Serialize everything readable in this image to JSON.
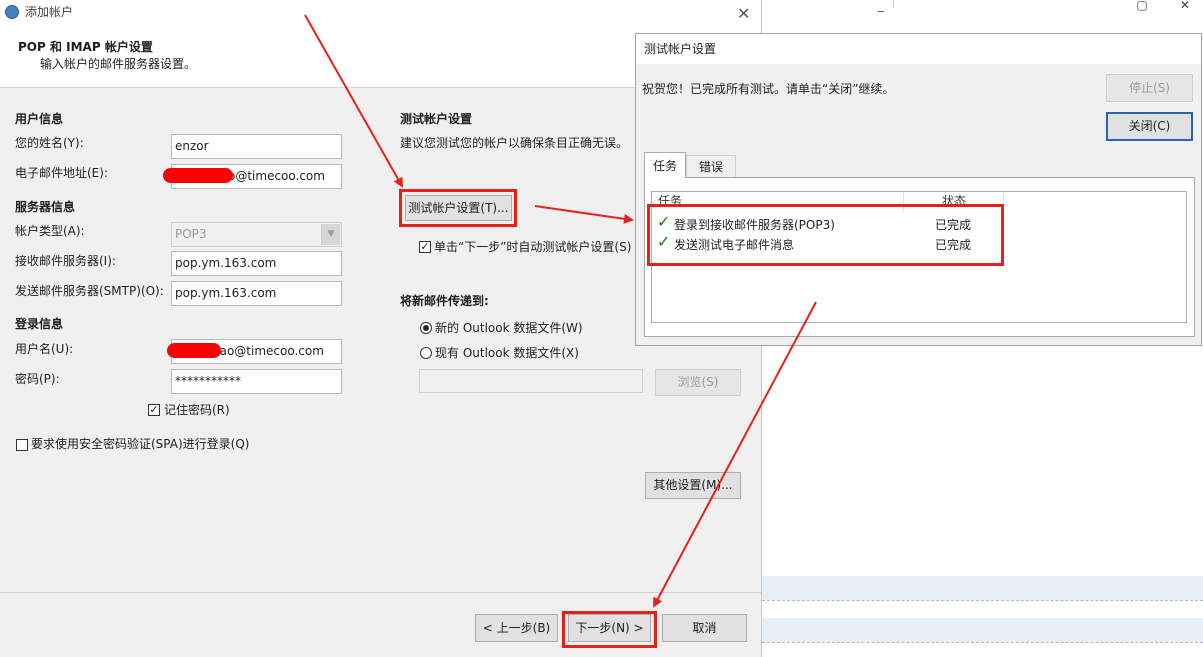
{
  "background_app": {
    "close_glyph": "✕"
  },
  "main_dialog": {
    "window_title": "添加帐户",
    "close_glyph": "✕",
    "header": {
      "title": "POP 和 IMAP 帐户设置",
      "subtitle": "输入帐户的邮件服务器设置。"
    },
    "user_info": {
      "section_label": "用户信息",
      "name_label": "您的姓名(Y):",
      "name_value": "enzor",
      "email_label": "电子邮件地址(E):",
      "email_value": "o@timecoo.com"
    },
    "server_info": {
      "section_label": "服务器信息",
      "account_type_label": "帐户类型(A):",
      "account_type_value": "POP3",
      "incoming_label": "接收邮件服务器(I):",
      "incoming_value": "pop.ym.163.com",
      "outgoing_label": "发送邮件服务器(SMTP)(O):",
      "outgoing_value": "pop.ym.163.com"
    },
    "login_info": {
      "section_label": "登录信息",
      "username_label": "用户名(U):",
      "username_value": "hao@timecoo.com",
      "password_label": "密码(P):",
      "password_value": "***********",
      "remember_label": "记住密码(R)",
      "remember_checked": true,
      "spa_label": "要求使用安全密码验证(SPA)进行登录(Q)",
      "spa_checked": false
    },
    "test_settings": {
      "section_label": "测试帐户设置",
      "description": "建议您测试您的帐户以确保条目正确无误。",
      "test_button": "测试帐户设置(T)...",
      "auto_test_label": "单击“下一步”时自动测试帐户设置(S)",
      "auto_test_checked": true
    },
    "deliver_to": {
      "section_label": "将新邮件传递到:",
      "option_new": "新的 Outlook 数据文件(W)",
      "option_existing": "现有 Outlook 数据文件(X)",
      "selected": "new",
      "existing_path": "",
      "browse_button": "浏览(S)"
    },
    "more_settings_button": "其他设置(M)...",
    "footer": {
      "back_button": "< 上一步(B)",
      "next_button": "下一步(N) >",
      "cancel_button": "取消"
    }
  },
  "test_dialog": {
    "title": "测试帐户设置",
    "message": "祝贺您！已完成所有测试。请单击“关闭”继续。",
    "stop_button": "停止(S)",
    "close_button": "关闭(C)",
    "tabs": [
      {
        "label": "任务",
        "active": true
      },
      {
        "label": "错误",
        "active": false
      }
    ],
    "columns": {
      "task": "任务",
      "status": "状态"
    },
    "tasks": [
      {
        "name": "登录到接收邮件服务器(POP3)",
        "status": "已完成"
      },
      {
        "name": "发送测试电子邮件消息",
        "status": "已完成"
      }
    ]
  },
  "annotations": {
    "highlight_color": "#e5211c"
  }
}
